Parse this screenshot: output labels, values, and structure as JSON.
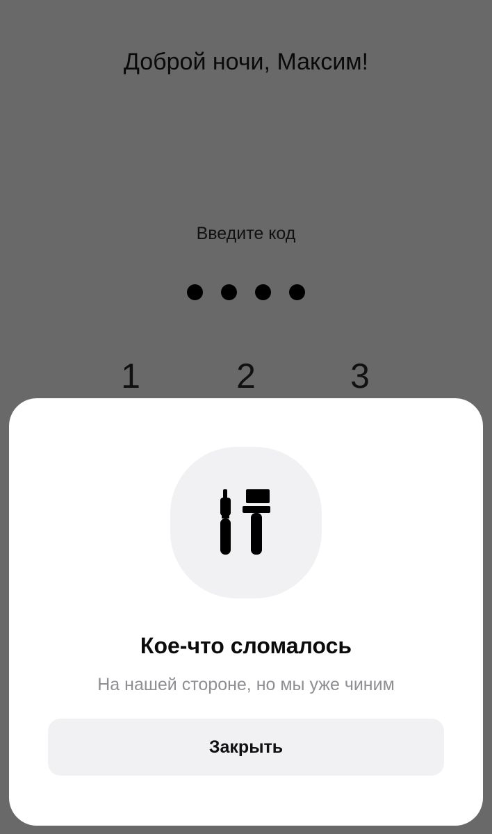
{
  "lock_screen": {
    "greeting": "Доброй ночи, Максим!",
    "prompt": "Введите код",
    "entered_digits": 4,
    "keypad": {
      "visible_keys": [
        "1",
        "2",
        "3"
      ]
    }
  },
  "error_sheet": {
    "icon": "tools-icon",
    "title": "Кое-что сломалось",
    "subtitle": "На нашей стороне, но мы уже чиним",
    "close_label": "Закрыть"
  },
  "colors": {
    "overlay": "#696969",
    "sheet_bg": "#ffffff",
    "tile_bg": "#f1f1f3",
    "subtitle": "#8e8e93"
  }
}
